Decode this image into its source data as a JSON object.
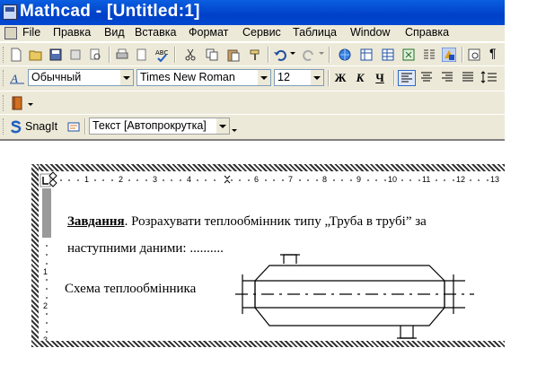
{
  "window": {
    "title": "Mathcad - [Untitled:1]"
  },
  "menu": {
    "items": [
      "File",
      "Правка",
      "Вид",
      "Вставка",
      "Формат",
      "Сервис",
      "Таблица",
      "Window",
      "Справка"
    ]
  },
  "format_toolbar": {
    "style_value": "Обычный",
    "font_value": "Times New Roman",
    "size_value": "12",
    "bold_label": "Ж",
    "italic_label": "К",
    "underline_label": "Ч"
  },
  "snagit_toolbar": {
    "snagit_label": "SnagIt",
    "mode_value": "Текст [Автопрокрутка]"
  },
  "ruler": {
    "numbers": [
      "1",
      "2",
      "3",
      "4",
      "5",
      "6",
      "7",
      "8",
      "9",
      "10",
      "11",
      "12",
      "13"
    ],
    "vnumbers": [
      "1",
      "2",
      "3"
    ]
  },
  "document": {
    "task_label": "Завдання",
    "task_text": ". Розрахувати теплообмінник типу „Труба в трубі” за",
    "task_text2": "наступними даними:    ..........",
    "diagram_caption": "Схема теплообмінника"
  }
}
